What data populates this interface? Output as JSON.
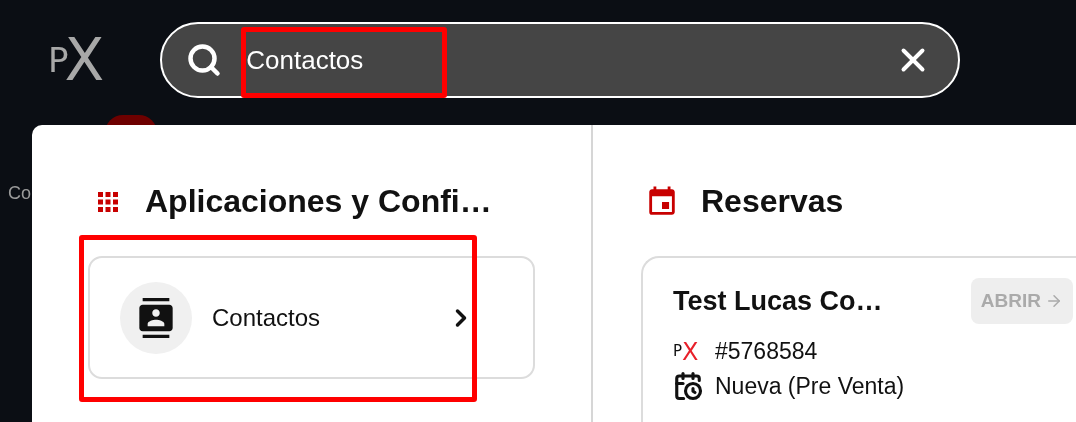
{
  "logo": "PX",
  "search": {
    "value": "Contactos"
  },
  "sidebar": {
    "label": "Co"
  },
  "sections": [
    {
      "kind": "apps",
      "title": "Aplicaciones y Confi…",
      "items": [
        {
          "label": "Contactos"
        }
      ]
    },
    {
      "kind": "bookings",
      "title": "Reservas",
      "items": [
        {
          "title": "Test Lucas Co…",
          "action": "ABRIR",
          "mark": "PX",
          "number": "#5768584",
          "status": "Nueva (Pre Venta)"
        }
      ]
    }
  ]
}
